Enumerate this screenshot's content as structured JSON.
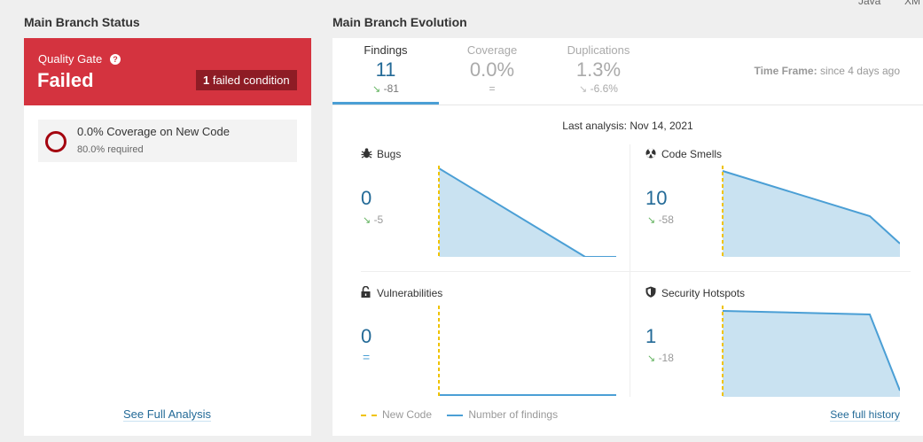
{
  "top_cut": {
    "left_text": "Java",
    "right_text": "XM"
  },
  "left": {
    "section_title": "Main Branch Status",
    "quality_gate": {
      "label": "Quality Gate",
      "help": "?",
      "status": "Failed",
      "badge_count": "1",
      "badge_text": "failed condition",
      "color": "#d4333f"
    },
    "condition": {
      "text": "0.0% Coverage on New Code",
      "required": "80.0% required",
      "ring_color": "#a4030f"
    },
    "see_full_analysis": "See Full Analysis"
  },
  "right": {
    "section_title": "Main Branch Evolution",
    "tabs": [
      {
        "name": "Findings",
        "value": "11",
        "delta": "-81",
        "delta_icon": "↘",
        "active": true
      },
      {
        "name": "Coverage",
        "value": "0.0%",
        "delta": "=",
        "delta_icon": "",
        "active": false
      },
      {
        "name": "Duplications",
        "value": "1.3%",
        "delta": "-6.6%",
        "delta_icon": "↘",
        "active": false
      }
    ],
    "time_frame": {
      "label": "Time Frame:",
      "value": "since 4 days ago"
    },
    "last_analysis": "Last analysis: Nov 14, 2021",
    "metrics": {
      "bugs": {
        "name": "Bugs",
        "icon": "bug-icon",
        "value": "0",
        "delta": "-5",
        "delta_icon": "↘"
      },
      "code_smells": {
        "name": "Code Smells",
        "icon": "radiation-icon",
        "value": "10",
        "delta": "-58",
        "delta_icon": "↘"
      },
      "vulnerabilities": {
        "name": "Vulnerabilities",
        "icon": "lock-icon",
        "value": "0",
        "delta": "=",
        "delta_icon": ""
      },
      "security_hotspots": {
        "name": "Security Hotspots",
        "icon": "shield-icon",
        "value": "1",
        "delta": "-18",
        "delta_icon": "↘"
      }
    },
    "legend": {
      "new_code": "New Code",
      "findings": "Number of findings"
    },
    "see_full_history": "See full history",
    "colors": {
      "accent": "#4b9fd5",
      "link": "#236a97",
      "new_code": "#f0c300",
      "area_fill": "#c9e2f1",
      "down_arrow": "#60b25d"
    }
  }
}
